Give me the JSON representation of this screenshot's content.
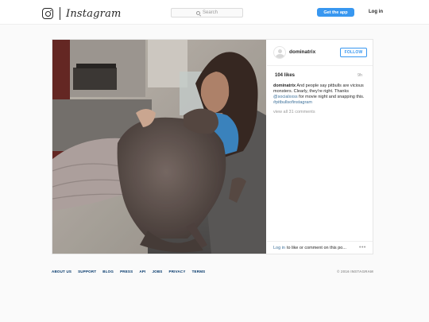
{
  "topbar": {
    "brand_word": "Instagram",
    "search_placeholder": "Search",
    "get_app_label": "Get the app",
    "login_label": "Log in"
  },
  "post": {
    "username": "dominatrix",
    "follow_label": "FOLLOW",
    "likes": "104 likes",
    "time": "9h",
    "caption": {
      "author": "dominatrix",
      "text_1": " And people say pitbulls are vicious monsters. Clearly, they're right. Thanks ",
      "mention": "@socialxxss",
      "text_2": " for movie night and snapping this. ",
      "hashtag": "#pitbullsofinstagram"
    },
    "view_all": "view all 31 comments",
    "comment_login": "Log in",
    "comment_text": "to like or comment on this po...",
    "more": "•••"
  },
  "footer": {
    "links": [
      "ABOUT US",
      "SUPPORT",
      "BLOG",
      "PRESS",
      "API",
      "JOBS",
      "PRIVACY",
      "TERMS"
    ],
    "copyright": "© 2016 INSTAGRAM"
  },
  "colors": {
    "accent": "#3897f0",
    "link": "#3f729b",
    "footer_link": "#003569",
    "muted": "#999999"
  },
  "icons": [
    "instagram-camera-icon",
    "search-icon",
    "avatar-placeholder-icon",
    "more-options-icon"
  ]
}
